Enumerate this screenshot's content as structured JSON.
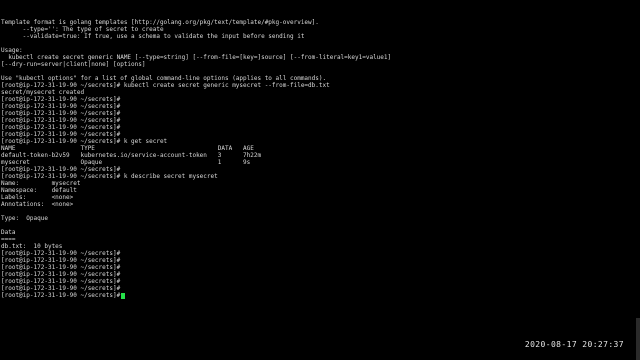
{
  "terminal": {
    "lines_top": [
      "Template format is golang templates [http://golang.org/pkg/text/template/#pkg-overview].",
      "      --type='': The type of secret to create",
      "      --validate=true: If true, use a schema to validate the input before sending it",
      "",
      "Usage:",
      "  kubectl create secret generic NAME [--type=string] [--from-file=[key=]source] [--from-literal=key1=value1]",
      "[--dry-run=server|client|none] [options]",
      "",
      "Use \"kubectl options\" for a list of global command-line options (applies to all commands).",
      "[root@ip-172-31-19-90 ~/secrets]# kubectl create secret generic mysecret --from-file=db.txt",
      "secret/mysecret created",
      "[root@ip-172-31-19-90 ~/secrets]#",
      "[root@ip-172-31-19-90 ~/secrets]#",
      "[root@ip-172-31-19-90 ~/secrets]#",
      "[root@ip-172-31-19-90 ~/secrets]#",
      "[root@ip-172-31-19-90 ~/secrets]#",
      "[root@ip-172-31-19-90 ~/secrets]#",
      "[root@ip-172-31-19-90 ~/secrets]# k get secret",
      "NAME                  TYPE                                  DATA   AGE",
      "default-token-b2v59   kubernetes.io/service-account-token   3      7h22m",
      "mysecret              Opaque                                1      9s",
      "[root@ip-172-31-19-90 ~/secrets]#",
      "[root@ip-172-31-19-90 ~/secrets]# k describe secret mysecret",
      "Name:         mysecret",
      "Namespace:    default",
      "Labels:       <none>",
      "Annotations:  <none>",
      "",
      "Type:  Opaque",
      "",
      "Data",
      "====",
      "db.txt:  10 bytes",
      "[root@ip-172-31-19-90 ~/secrets]#",
      "[root@ip-172-31-19-90 ~/secrets]#",
      "[root@ip-172-31-19-90 ~/secrets]#",
      "[root@ip-172-31-19-90 ~/secrets]#",
      "[root@ip-172-31-19-90 ~/secrets]#",
      "[root@ip-172-31-19-90 ~/secrets]#"
    ],
    "current_prompt": "[root@ip-172-31-19-90 ~/secrets]#",
    "timestamp": "2020-08-17 20:27:37",
    "colors": {
      "background": "#000000",
      "text": "#d9d9d9",
      "cursor": "#25e24a"
    }
  }
}
